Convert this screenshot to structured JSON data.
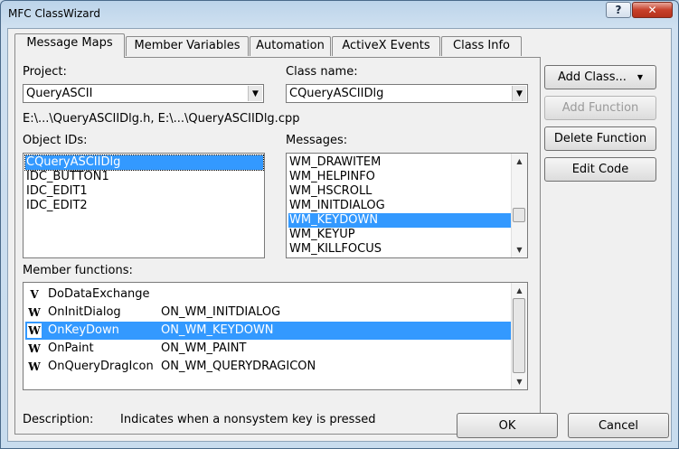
{
  "window": {
    "title": "MFC ClassWizard",
    "help_label": "?",
    "close_label": "✕"
  },
  "tabs": [
    {
      "label": "Message Maps",
      "active": true
    },
    {
      "label": "Member Variables"
    },
    {
      "label": "Automation"
    },
    {
      "label": "ActiveX Events"
    },
    {
      "label": "Class Info"
    }
  ],
  "project": {
    "label": "Project:",
    "value": "QueryASCII"
  },
  "class_name": {
    "label": "Class name:",
    "value": "CQueryASCIIDlg"
  },
  "file_path": "E:\\...\\QueryASCIIDlg.h, E:\\...\\QueryASCIIDlg.cpp",
  "object_ids": {
    "label": "Object IDs:",
    "items": [
      "CQueryASCIIDlg",
      "IDC_BUTTON1",
      "IDC_EDIT1",
      "IDC_EDIT2"
    ],
    "selected": "CQueryASCIIDlg"
  },
  "messages": {
    "label": "Messages:",
    "items": [
      "WM_DRAWITEM",
      "WM_HELPINFO",
      "WM_HSCROLL",
      "WM_INITDIALOG",
      "WM_KEYDOWN",
      "WM_KEYUP",
      "WM_KILLFOCUS"
    ],
    "selected": "WM_KEYDOWN"
  },
  "member_functions": {
    "label": "Member functions:",
    "rows": [
      {
        "icon": "V",
        "name": "DoDataExchange",
        "map": ""
      },
      {
        "icon": "W",
        "name": "OnInitDialog",
        "map": "ON_WM_INITDIALOG"
      },
      {
        "icon": "W",
        "name": "OnKeyDown",
        "map": "ON_WM_KEYDOWN",
        "selected": true
      },
      {
        "icon": "W",
        "name": "OnPaint",
        "map": "ON_WM_PAINT"
      },
      {
        "icon": "W",
        "name": "OnQueryDragIcon",
        "map": "ON_WM_QUERYDRAGICON"
      }
    ]
  },
  "description": {
    "label": "Description:",
    "text": "Indicates when a nonsystem key is pressed"
  },
  "buttons": {
    "add_class": "Add Class...",
    "add_class_arrow": "▼",
    "add_function": "Add Function",
    "delete_function": "Delete Function",
    "edit_code": "Edit Code",
    "ok": "OK",
    "cancel": "Cancel"
  },
  "colors": {
    "selection": "#3399ff",
    "dialog_bg": "#f0f0f0"
  }
}
